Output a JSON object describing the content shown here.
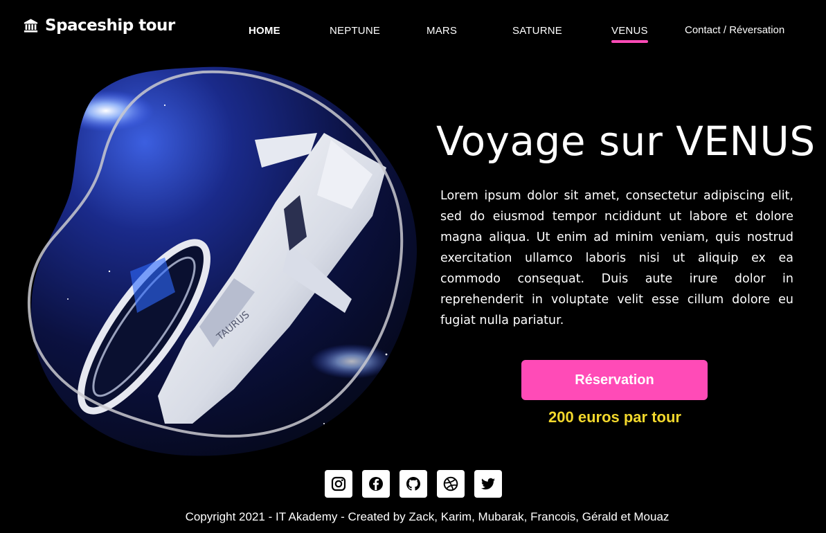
{
  "colors": {
    "accent": "#ff4bb7",
    "price": "#f3d82c",
    "background": "#000000"
  },
  "header": {
    "logo_icon": "bank-icon",
    "brand": "Spaceship tour",
    "nav": [
      {
        "label": "HOME"
      },
      {
        "label": "NEPTUNE"
      },
      {
        "label": "MARS"
      },
      {
        "label": "SATURNE"
      },
      {
        "label": "VENUS"
      }
    ],
    "contact": "Contact / Réversation"
  },
  "hero": {
    "image": "spaceship-image",
    "title": "Voyage sur VENUS",
    "description": "Lorem ipsum dolor sit amet, consectetur adipiscing elit, sed do eiusmod tempor ncididunt ut labore et dolore magna aliqua. Ut enim ad minim veniam, quis nostrud exercitation ullamco laboris nisi ut aliquip ex ea commodo consequat. Duis aute irure dolor in reprehenderit in voluptate velit esse cillum dolore eu fugiat nulla pariatur.",
    "cta": "Réservation",
    "price": "200 euros par tour",
    "ship_text": "TAURUS"
  },
  "footer": {
    "socials": [
      "instagram-icon",
      "facebook-icon",
      "github-icon",
      "dribbble-icon",
      "twitter-icon"
    ],
    "copyright": "Copyright 2021 - IT Akademy - Created by Zack, Karim, Mubarak, Francois, Gérald et Mouaz"
  }
}
